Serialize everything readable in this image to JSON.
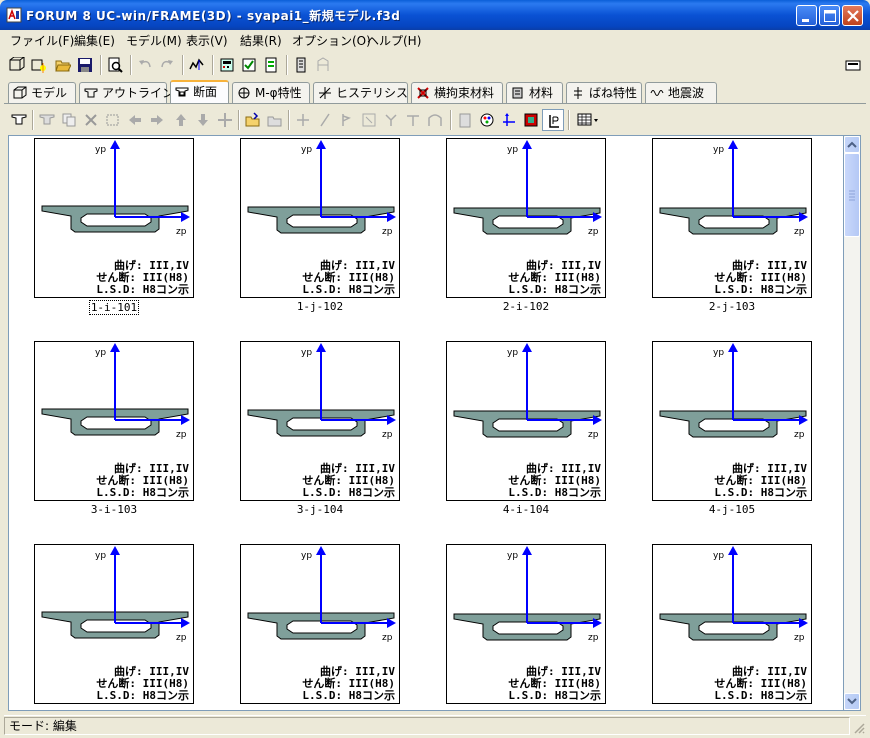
{
  "window": {
    "title": "FORUM 8  UC-win/FRAME(3D) - syapai1_新規モデル.f3d"
  },
  "menu": [
    "ファイル(F)",
    "編集(E)",
    "モデル(M)",
    "表示(V)",
    "結果(R)",
    "オプション(O)",
    "ヘルプ(H)"
  ],
  "tabs": [
    {
      "label": "モデル",
      "icon": "model-icon"
    },
    {
      "label": "アウトライン",
      "icon": "outline-icon"
    },
    {
      "label": "断面",
      "icon": "section-icon",
      "active": true
    },
    {
      "label": "M-φ特性",
      "icon": "m-phi-icon"
    },
    {
      "label": "ヒステリシス",
      "icon": "hysteresis-icon"
    },
    {
      "label": "横拘束材料",
      "icon": "lateral-confinement-icon"
    },
    {
      "label": "材料",
      "icon": "material-icon"
    },
    {
      "label": "ばね特性",
      "icon": "spring-icon"
    },
    {
      "label": "地震波",
      "icon": "seismic-wave-icon"
    }
  ],
  "axis_labels": {
    "y": "yp",
    "z": "zp"
  },
  "sections": [
    {
      "name": "1-i-101",
      "info1": "曲げ: III,IV",
      "info2": "せん断: III(H8)",
      "info3": "L.S.D: H8コン示",
      "selected": true
    },
    {
      "name": "1-j-102",
      "info1": "曲げ: III,IV",
      "info2": "せん断: III(H8)",
      "info3": "L.S.D: H8コン示"
    },
    {
      "name": "2-i-102",
      "info1": "曲げ: III,IV",
      "info2": "せん断: III(H8)",
      "info3": "L.S.D: H8コン示"
    },
    {
      "name": "2-j-103",
      "info1": "曲げ: III,IV",
      "info2": "せん断: III(H8)",
      "info3": "L.S.D: H8コン示"
    },
    {
      "name": "3-i-103",
      "info1": "曲げ: III,IV",
      "info2": "せん断: III(H8)",
      "info3": "L.S.D: H8コン示"
    },
    {
      "name": "3-j-104",
      "info1": "曲げ: III,IV",
      "info2": "せん断: III(H8)",
      "info3": "L.S.D: H8コン示"
    },
    {
      "name": "4-i-104",
      "info1": "曲げ: III,IV",
      "info2": "せん断: III(H8)",
      "info3": "L.S.D: H8コン示"
    },
    {
      "name": "4-j-105",
      "info1": "曲げ: III,IV",
      "info2": "せん断: III(H8)",
      "info3": "L.S.D: H8コン示"
    },
    {
      "name": "",
      "info1": "曲げ: III,IV",
      "info2": "せん断: III(H8)",
      "info3": "L.S.D: H8コン示"
    },
    {
      "name": "",
      "info1": "曲げ: III,IV",
      "info2": "せん断: III(H8)",
      "info3": "L.S.D: H8コン示"
    },
    {
      "name": "",
      "info1": "曲げ: III,IV",
      "info2": "せん断: III(H8)",
      "info3": "L.S.D: H8コン示"
    },
    {
      "name": "",
      "info1": "曲げ: III,IV",
      "info2": "せん断: III(H8)",
      "info3": "L.S.D: H8コン示"
    }
  ],
  "colors": {
    "section_fill": "#7f9f9a",
    "axis": "#0000ff",
    "accent_tab": "#f7b23b"
  },
  "status": {
    "mode": "モード: 編集"
  }
}
